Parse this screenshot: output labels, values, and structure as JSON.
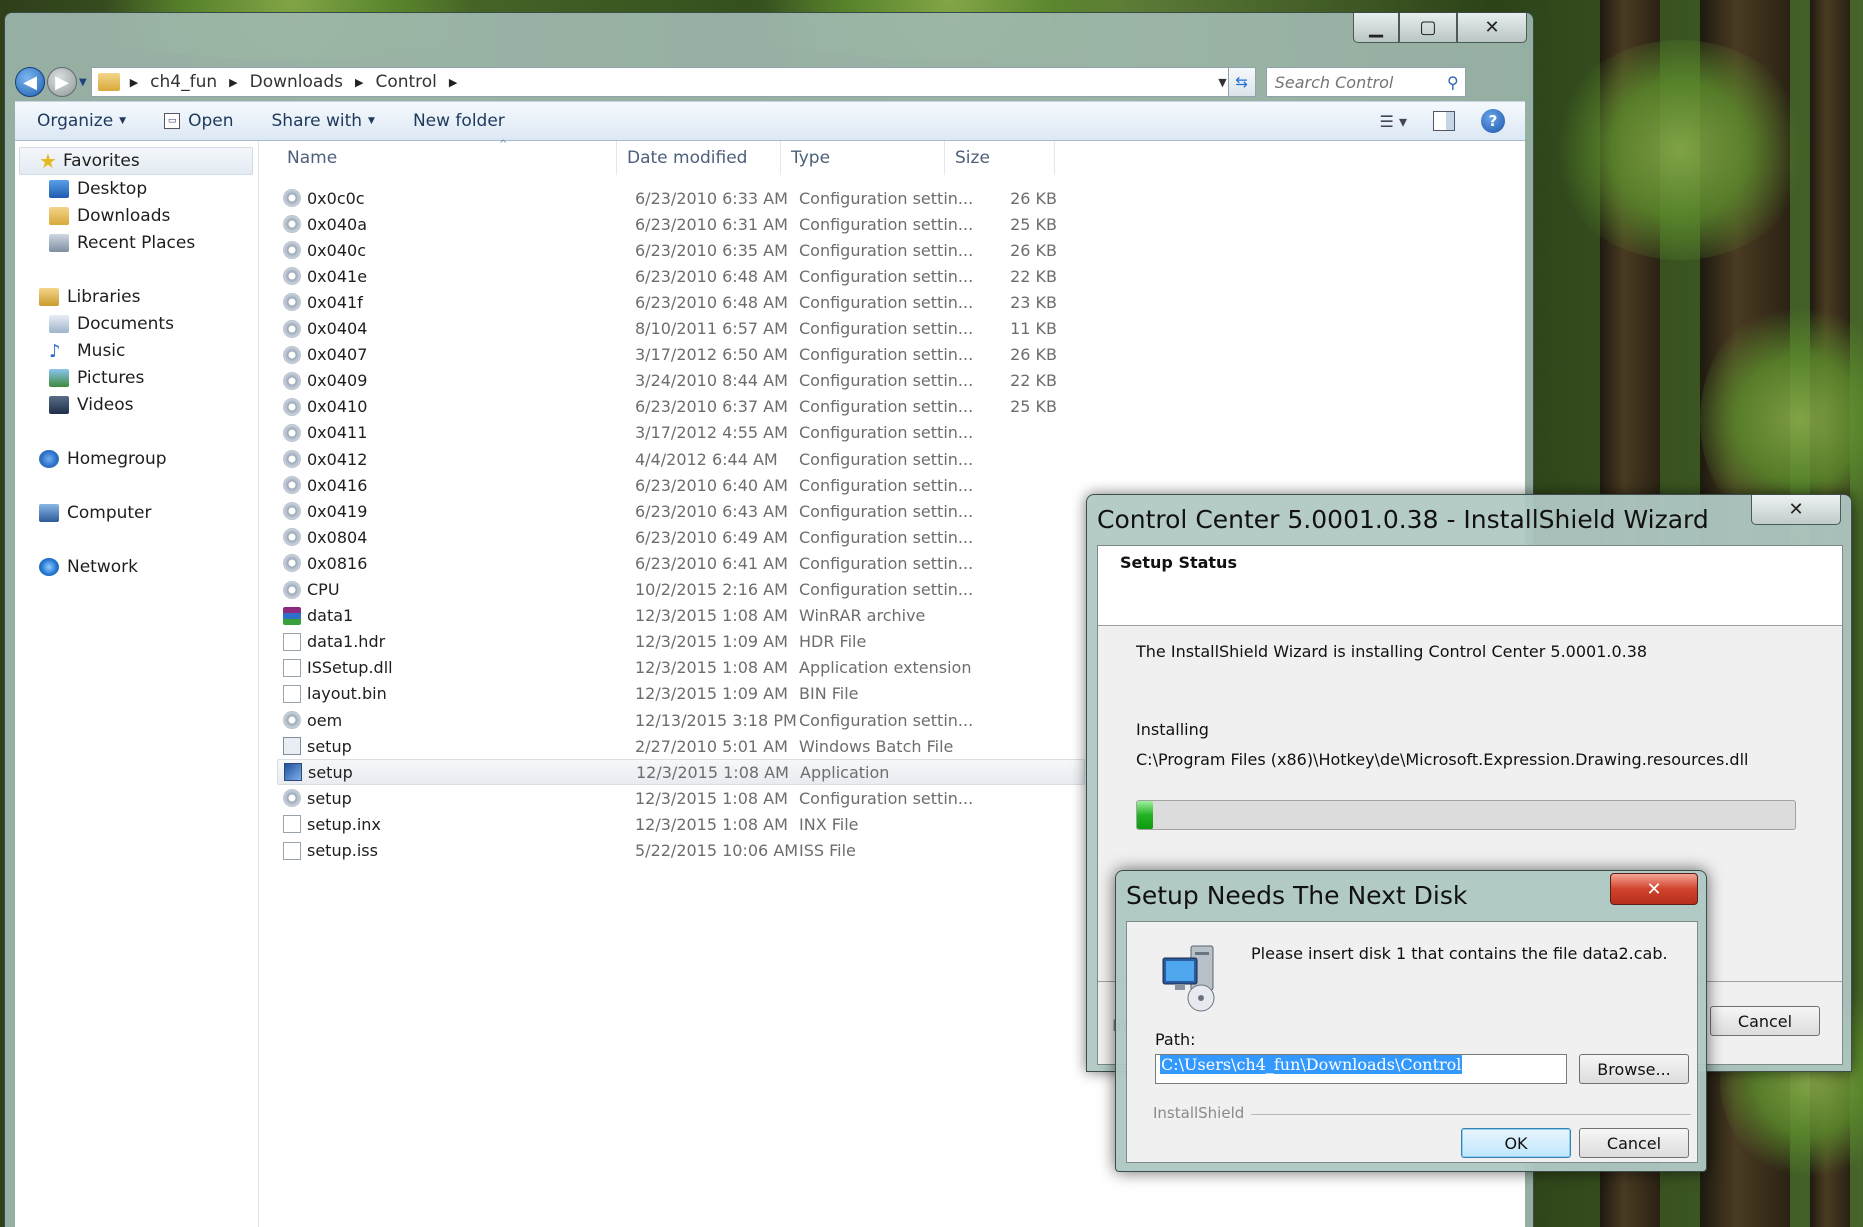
{
  "explorer": {
    "breadcrumb": [
      "ch4_fun",
      "Downloads",
      "Control"
    ],
    "search": {
      "placeholder": "Search Control"
    },
    "toolbar": {
      "organize": "Organize",
      "open": "Open",
      "share_with": "Share with",
      "new_folder": "New folder"
    },
    "nav": {
      "favorites": "Favorites",
      "desktop": "Desktop",
      "downloads": "Downloads",
      "recent_places": "Recent Places",
      "libraries": "Libraries",
      "documents": "Documents",
      "music": "Music",
      "pictures": "Pictures",
      "videos": "Videos",
      "homegroup": "Homegroup",
      "computer": "Computer",
      "network": "Network"
    },
    "columns": {
      "name": "Name",
      "date": "Date modified",
      "type": "Type",
      "size": "Size"
    },
    "files": [
      {
        "name": "0x0c0c",
        "date": "6/23/2010 6:33 AM",
        "type": "Configuration settin...",
        "size": "26 KB",
        "icon": "config-file-icon"
      },
      {
        "name": "0x040a",
        "date": "6/23/2010 6:31 AM",
        "type": "Configuration settin...",
        "size": "25 KB",
        "icon": "config-file-icon"
      },
      {
        "name": "0x040c",
        "date": "6/23/2010 6:35 AM",
        "type": "Configuration settin...",
        "size": "26 KB",
        "icon": "config-file-icon"
      },
      {
        "name": "0x041e",
        "date": "6/23/2010 6:48 AM",
        "type": "Configuration settin...",
        "size": "22 KB",
        "icon": "config-file-icon"
      },
      {
        "name": "0x041f",
        "date": "6/23/2010 6:48 AM",
        "type": "Configuration settin...",
        "size": "23 KB",
        "icon": "config-file-icon"
      },
      {
        "name": "0x0404",
        "date": "8/10/2011 6:57 AM",
        "type": "Configuration settin...",
        "size": "11 KB",
        "icon": "config-file-icon"
      },
      {
        "name": "0x0407",
        "date": "3/17/2012 6:50 AM",
        "type": "Configuration settin...",
        "size": "26 KB",
        "icon": "config-file-icon"
      },
      {
        "name": "0x0409",
        "date": "3/24/2010 8:44 AM",
        "type": "Configuration settin...",
        "size": "22 KB",
        "icon": "config-file-icon"
      },
      {
        "name": "0x0410",
        "date": "6/23/2010 6:37 AM",
        "type": "Configuration settin...",
        "size": "25 KB",
        "icon": "config-file-icon"
      },
      {
        "name": "0x0411",
        "date": "3/17/2012 4:55 AM",
        "type": "Configuration settin...",
        "size": "",
        "icon": "config-file-icon"
      },
      {
        "name": "0x0412",
        "date": "4/4/2012 6:44 AM",
        "type": "Configuration settin...",
        "size": "",
        "icon": "config-file-icon"
      },
      {
        "name": "0x0416",
        "date": "6/23/2010 6:40 AM",
        "type": "Configuration settin...",
        "size": "",
        "icon": "config-file-icon"
      },
      {
        "name": "0x0419",
        "date": "6/23/2010 6:43 AM",
        "type": "Configuration settin...",
        "size": "",
        "icon": "config-file-icon"
      },
      {
        "name": "0x0804",
        "date": "6/23/2010 6:49 AM",
        "type": "Configuration settin...",
        "size": "",
        "icon": "config-file-icon"
      },
      {
        "name": "0x0816",
        "date": "6/23/2010 6:41 AM",
        "type": "Configuration settin...",
        "size": "",
        "icon": "config-file-icon"
      },
      {
        "name": "CPU",
        "date": "10/2/2015 2:16 AM",
        "type": "Configuration settin...",
        "size": "",
        "icon": "config-file-icon"
      },
      {
        "name": "data1",
        "date": "12/3/2015 1:08 AM",
        "type": "WinRAR archive",
        "size": "",
        "icon": "winrar-archive-icon"
      },
      {
        "name": "data1.hdr",
        "date": "12/3/2015 1:09 AM",
        "type": "HDR File",
        "size": "",
        "icon": "blank-file-icon"
      },
      {
        "name": "ISSetup.dll",
        "date": "12/3/2015 1:08 AM",
        "type": "Application extension",
        "size": "",
        "icon": "dll-file-icon"
      },
      {
        "name": "layout.bin",
        "date": "12/3/2015 1:09 AM",
        "type": "BIN File",
        "size": "",
        "icon": "blank-file-icon"
      },
      {
        "name": "oem",
        "date": "12/13/2015 3:18 PM",
        "type": "Configuration settin...",
        "size": "",
        "icon": "config-file-icon"
      },
      {
        "name": "setup",
        "date": "2/27/2010 5:01 AM",
        "type": "Windows Batch File",
        "size": "",
        "icon": "batch-file-icon"
      },
      {
        "name": "setup",
        "date": "12/3/2015 1:08 AM",
        "type": "Application",
        "size": "",
        "icon": "application-icon",
        "selected": true
      },
      {
        "name": "setup",
        "date": "12/3/2015 1:08 AM",
        "type": "Configuration settin...",
        "size": "",
        "icon": "config-file-icon"
      },
      {
        "name": "setup.inx",
        "date": "12/3/2015 1:08 AM",
        "type": "INX File",
        "size": "",
        "icon": "blank-file-icon"
      },
      {
        "name": "setup.iss",
        "date": "5/22/2015 10:06 AM",
        "type": "ISS File",
        "size": "",
        "icon": "blank-file-icon"
      }
    ]
  },
  "wizard": {
    "title": "Control Center 5.0001.0.38 - InstallShield Wizard",
    "header": "Setup Status",
    "message": "The InstallShield Wizard is installing Control Center 5.0001.0.38",
    "status_label": "Installing",
    "current_file": "C:\\Program Files (x86)\\Hotkey\\de\\Microsoft.Expression.Drawing.resources.dll",
    "progress": 0.025,
    "cancel": "Cancel",
    "progress_color": "#23b323"
  },
  "disk_dialog": {
    "title": "Setup Needs The Next Disk",
    "message": "Please insert disk 1 that contains the file data2.cab.",
    "path_label": "Path:",
    "path_value": "C:\\Users\\ch4_fun\\Downloads\\Control",
    "browse": "Browse...",
    "brand": "InstallShield",
    "ok": "OK",
    "cancel": "Cancel",
    "close_color": "#d1432c"
  }
}
